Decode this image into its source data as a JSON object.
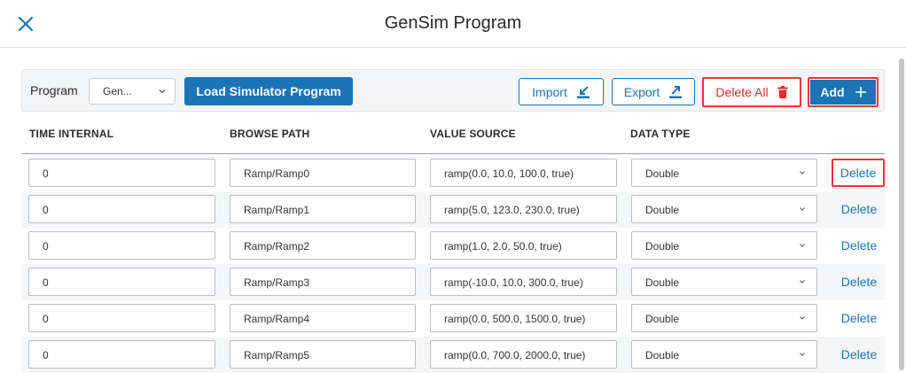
{
  "dialog": {
    "title": "GenSim Program"
  },
  "toolbar": {
    "program_label": "Program",
    "program_value": "Gen...",
    "load_label": "Load Simulator Program",
    "import_label": "Import",
    "export_label": "Export",
    "delete_all_label": "Delete All",
    "add_label": "Add"
  },
  "table": {
    "columns": [
      "TIME INTERNAL",
      "BROWSE PATH",
      "VALUE SOURCE",
      "DATA TYPE"
    ],
    "delete_label": "Delete",
    "rows": [
      {
        "time": "0",
        "path": "Ramp/Ramp0",
        "value": "ramp(0.0, 10.0, 100.0, true)",
        "type": "Double"
      },
      {
        "time": "0",
        "path": "Ramp/Ramp1",
        "value": "ramp(5.0, 123.0, 230.0, true)",
        "type": "Double"
      },
      {
        "time": "0",
        "path": "Ramp/Ramp2",
        "value": "ramp(1.0, 2.0, 50.0, true)",
        "type": "Double"
      },
      {
        "time": "0",
        "path": "Ramp/Ramp3",
        "value": "ramp(-10.0, 10.0, 300.0, true)",
        "type": "Double"
      },
      {
        "time": "0",
        "path": "Ramp/Ramp4",
        "value": "ramp(0.0, 500.0, 1500.0, true)",
        "type": "Double"
      },
      {
        "time": "0",
        "path": "Ramp/Ramp5",
        "value": "ramp(0.0, 700.0, 2000.0, true)",
        "type": "Double"
      }
    ]
  },
  "colors": {
    "accent": "#1c74b5",
    "danger": "#e02b2b",
    "highlight": "#e8353d"
  },
  "icons": {
    "close": "close-icon",
    "import": "import-icon",
    "export": "export-icon",
    "trash": "trash-icon",
    "plus": "plus-icon",
    "chevron": "chevron-down-icon"
  }
}
